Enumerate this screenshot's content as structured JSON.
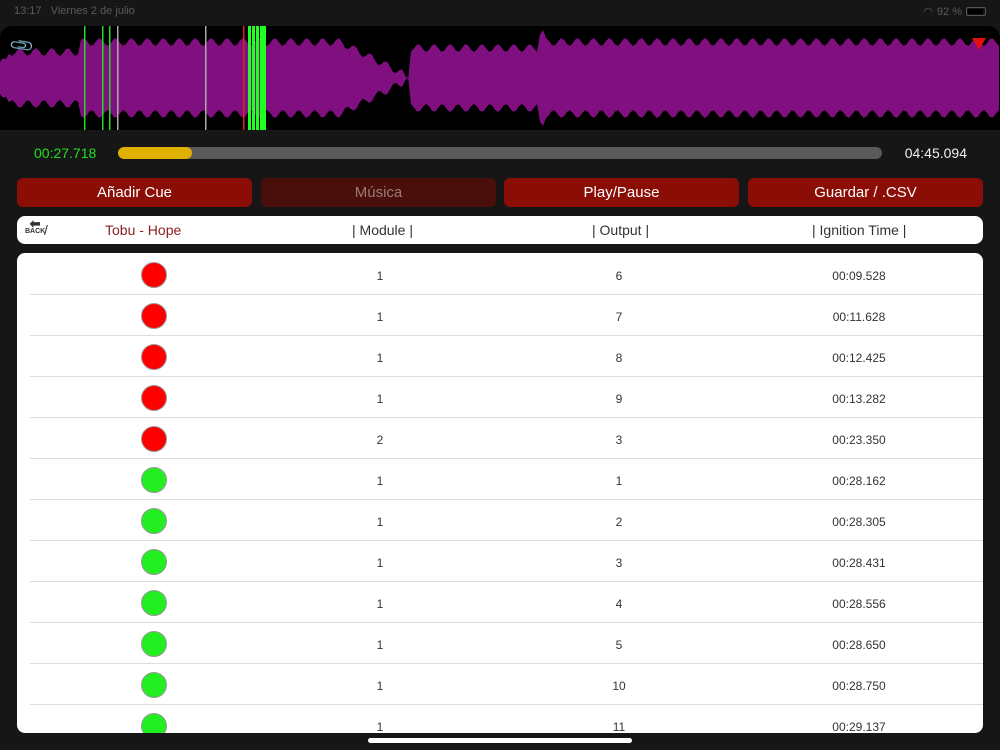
{
  "status": {
    "time": "13:17",
    "date": "Viernes 2 de julio",
    "battery": "92 %"
  },
  "player": {
    "current_time": "00:27.718",
    "total_time": "04:45.094",
    "progress": 0.097
  },
  "buttons": {
    "add_cue": "Añadir Cue",
    "music": "Música",
    "play_pause": "Play/Pause",
    "save": "Guardar / .CSV"
  },
  "header": {
    "back": "BACK",
    "slash": "/",
    "song": "Tobu - Hope",
    "module": "| Module |",
    "output": "| Output |",
    "ignition": "| Ignition Time |"
  },
  "colors": {
    "fired": "#ff0000",
    "pending": "#22ee22",
    "waveform": "#800f80"
  },
  "rows": [
    {
      "state": "fired",
      "module": "1",
      "output": "6",
      "time": "00:09.528"
    },
    {
      "state": "fired",
      "module": "1",
      "output": "7",
      "time": "00:11.628"
    },
    {
      "state": "fired",
      "module": "1",
      "output": "8",
      "time": "00:12.425"
    },
    {
      "state": "fired",
      "module": "1",
      "output": "9",
      "time": "00:13.282"
    },
    {
      "state": "fired",
      "module": "2",
      "output": "3",
      "time": "00:23.350"
    },
    {
      "state": "pending",
      "module": "1",
      "output": "1",
      "time": "00:28.162"
    },
    {
      "state": "pending",
      "module": "1",
      "output": "2",
      "time": "00:28.305"
    },
    {
      "state": "pending",
      "module": "1",
      "output": "3",
      "time": "00:28.431"
    },
    {
      "state": "pending",
      "module": "1",
      "output": "4",
      "time": "00:28.556"
    },
    {
      "state": "pending",
      "module": "1",
      "output": "5",
      "time": "00:28.650"
    },
    {
      "state": "pending",
      "module": "1",
      "output": "10",
      "time": "00:28.750"
    },
    {
      "state": "pending",
      "module": "1",
      "output": "11",
      "time": "00:29.137"
    }
  ]
}
